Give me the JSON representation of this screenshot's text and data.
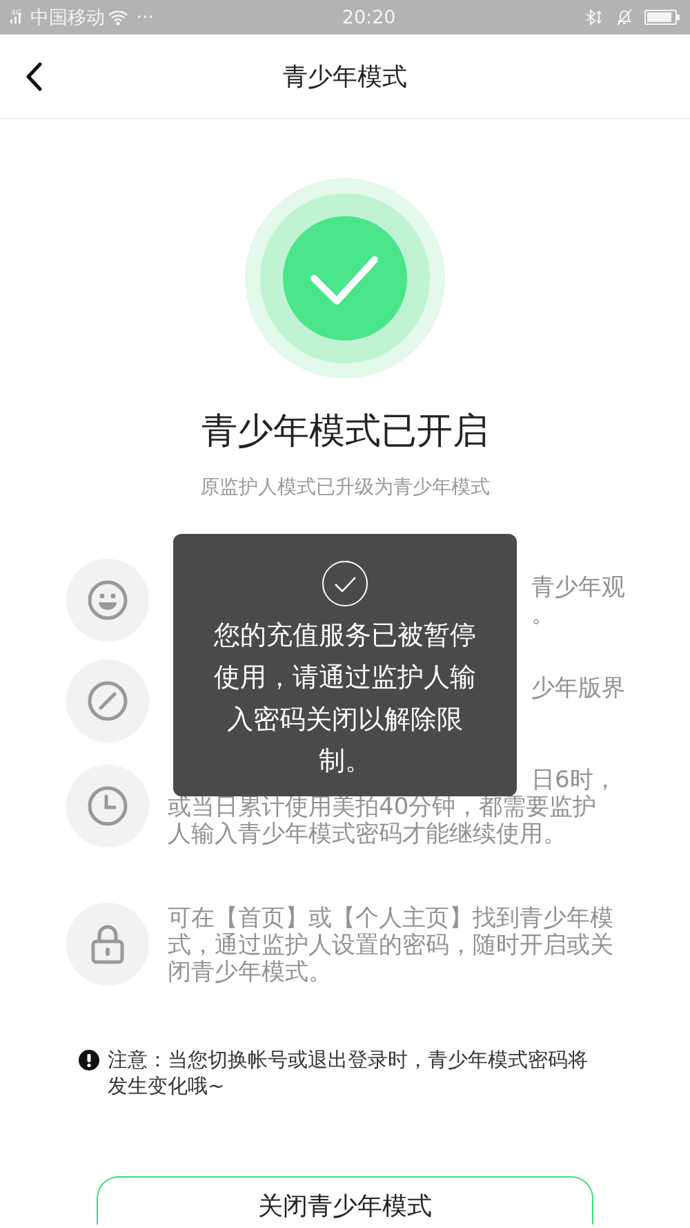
{
  "status_bar": {
    "network": "4G",
    "carrier": "中国移动",
    "more": "···",
    "time": "20:20"
  },
  "nav": {
    "title": "青少年模式"
  },
  "hero": {
    "title": "青少年模式已开启",
    "subtitle": "原监护人模式已升级为青少年模式"
  },
  "features": [
    {
      "kind": "smile",
      "lines": [
        {
          "text": "青少年观",
          "covered": true
        },
        {
          "text": "。",
          "covered": true
        }
      ]
    },
    {
      "kind": "ban",
      "lines": [
        {
          "text": "少年版界",
          "covered": true
        }
      ]
    },
    {
      "kind": "clock",
      "lines": [
        {
          "text": "日6时，",
          "covered": true
        },
        {
          "text": "或当日累计使用美拍40分钟，都需要监护",
          "covered": false
        },
        {
          "text": "人输入青少年模式密码才能继续使用。",
          "covered": false
        }
      ]
    },
    {
      "kind": "lock",
      "lines": [
        {
          "text": "可在【首页】或【个人主页】找到青少年模",
          "covered": false
        },
        {
          "text": "式，通过监护人设置的密码，随时开启或关",
          "covered": false
        },
        {
          "text": "闭青少年模式。",
          "covered": false
        }
      ]
    }
  ],
  "note": "注意：当您切换帐号或退出登录时，青少年模式密码将发生变化哦~",
  "button": "关闭青少年模式",
  "toast": "您的充值服务已被暂停使用，请通过监护人输入密码关闭以解除限制。"
}
